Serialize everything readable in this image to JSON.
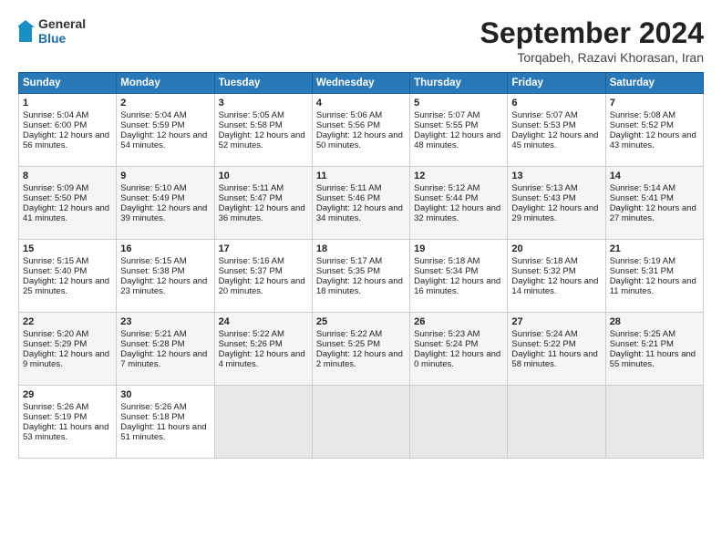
{
  "header": {
    "logo_line1": "General",
    "logo_line2": "Blue",
    "month_title": "September 2024",
    "location": "Torqabeh, Razavi Khorasan, Iran"
  },
  "days_of_week": [
    "Sunday",
    "Monday",
    "Tuesday",
    "Wednesday",
    "Thursday",
    "Friday",
    "Saturday"
  ],
  "weeks": [
    [
      {
        "day": "1",
        "sunrise": "Sunrise: 5:04 AM",
        "sunset": "Sunset: 6:00 PM",
        "daylight": "Daylight: 12 hours and 56 minutes."
      },
      {
        "day": "2",
        "sunrise": "Sunrise: 5:04 AM",
        "sunset": "Sunset: 5:59 PM",
        "daylight": "Daylight: 12 hours and 54 minutes."
      },
      {
        "day": "3",
        "sunrise": "Sunrise: 5:05 AM",
        "sunset": "Sunset: 5:58 PM",
        "daylight": "Daylight: 12 hours and 52 minutes."
      },
      {
        "day": "4",
        "sunrise": "Sunrise: 5:06 AM",
        "sunset": "Sunset: 5:56 PM",
        "daylight": "Daylight: 12 hours and 50 minutes."
      },
      {
        "day": "5",
        "sunrise": "Sunrise: 5:07 AM",
        "sunset": "Sunset: 5:55 PM",
        "daylight": "Daylight: 12 hours and 48 minutes."
      },
      {
        "day": "6",
        "sunrise": "Sunrise: 5:07 AM",
        "sunset": "Sunset: 5:53 PM",
        "daylight": "Daylight: 12 hours and 45 minutes."
      },
      {
        "day": "7",
        "sunrise": "Sunrise: 5:08 AM",
        "sunset": "Sunset: 5:52 PM",
        "daylight": "Daylight: 12 hours and 43 minutes."
      }
    ],
    [
      {
        "day": "8",
        "sunrise": "Sunrise: 5:09 AM",
        "sunset": "Sunset: 5:50 PM",
        "daylight": "Daylight: 12 hours and 41 minutes."
      },
      {
        "day": "9",
        "sunrise": "Sunrise: 5:10 AM",
        "sunset": "Sunset: 5:49 PM",
        "daylight": "Daylight: 12 hours and 39 minutes."
      },
      {
        "day": "10",
        "sunrise": "Sunrise: 5:11 AM",
        "sunset": "Sunset: 5:47 PM",
        "daylight": "Daylight: 12 hours and 36 minutes."
      },
      {
        "day": "11",
        "sunrise": "Sunrise: 5:11 AM",
        "sunset": "Sunset: 5:46 PM",
        "daylight": "Daylight: 12 hours and 34 minutes."
      },
      {
        "day": "12",
        "sunrise": "Sunrise: 5:12 AM",
        "sunset": "Sunset: 5:44 PM",
        "daylight": "Daylight: 12 hours and 32 minutes."
      },
      {
        "day": "13",
        "sunrise": "Sunrise: 5:13 AM",
        "sunset": "Sunset: 5:43 PM",
        "daylight": "Daylight: 12 hours and 29 minutes."
      },
      {
        "day": "14",
        "sunrise": "Sunrise: 5:14 AM",
        "sunset": "Sunset: 5:41 PM",
        "daylight": "Daylight: 12 hours and 27 minutes."
      }
    ],
    [
      {
        "day": "15",
        "sunrise": "Sunrise: 5:15 AM",
        "sunset": "Sunset: 5:40 PM",
        "daylight": "Daylight: 12 hours and 25 minutes."
      },
      {
        "day": "16",
        "sunrise": "Sunrise: 5:15 AM",
        "sunset": "Sunset: 5:38 PM",
        "daylight": "Daylight: 12 hours and 23 minutes."
      },
      {
        "day": "17",
        "sunrise": "Sunrise: 5:16 AM",
        "sunset": "Sunset: 5:37 PM",
        "daylight": "Daylight: 12 hours and 20 minutes."
      },
      {
        "day": "18",
        "sunrise": "Sunrise: 5:17 AM",
        "sunset": "Sunset: 5:35 PM",
        "daylight": "Daylight: 12 hours and 18 minutes."
      },
      {
        "day": "19",
        "sunrise": "Sunrise: 5:18 AM",
        "sunset": "Sunset: 5:34 PM",
        "daylight": "Daylight: 12 hours and 16 minutes."
      },
      {
        "day": "20",
        "sunrise": "Sunrise: 5:18 AM",
        "sunset": "Sunset: 5:32 PM",
        "daylight": "Daylight: 12 hours and 14 minutes."
      },
      {
        "day": "21",
        "sunrise": "Sunrise: 5:19 AM",
        "sunset": "Sunset: 5:31 PM",
        "daylight": "Daylight: 12 hours and 11 minutes."
      }
    ],
    [
      {
        "day": "22",
        "sunrise": "Sunrise: 5:20 AM",
        "sunset": "Sunset: 5:29 PM",
        "daylight": "Daylight: 12 hours and 9 minutes."
      },
      {
        "day": "23",
        "sunrise": "Sunrise: 5:21 AM",
        "sunset": "Sunset: 5:28 PM",
        "daylight": "Daylight: 12 hours and 7 minutes."
      },
      {
        "day": "24",
        "sunrise": "Sunrise: 5:22 AM",
        "sunset": "Sunset: 5:26 PM",
        "daylight": "Daylight: 12 hours and 4 minutes."
      },
      {
        "day": "25",
        "sunrise": "Sunrise: 5:22 AM",
        "sunset": "Sunset: 5:25 PM",
        "daylight": "Daylight: 12 hours and 2 minutes."
      },
      {
        "day": "26",
        "sunrise": "Sunrise: 5:23 AM",
        "sunset": "Sunset: 5:24 PM",
        "daylight": "Daylight: 12 hours and 0 minutes."
      },
      {
        "day": "27",
        "sunrise": "Sunrise: 5:24 AM",
        "sunset": "Sunset: 5:22 PM",
        "daylight": "Daylight: 11 hours and 58 minutes."
      },
      {
        "day": "28",
        "sunrise": "Sunrise: 5:25 AM",
        "sunset": "Sunset: 5:21 PM",
        "daylight": "Daylight: 11 hours and 55 minutes."
      }
    ],
    [
      {
        "day": "29",
        "sunrise": "Sunrise: 5:26 AM",
        "sunset": "Sunset: 5:19 PM",
        "daylight": "Daylight: 11 hours and 53 minutes."
      },
      {
        "day": "30",
        "sunrise": "Sunrise: 5:26 AM",
        "sunset": "Sunset: 5:18 PM",
        "daylight": "Daylight: 11 hours and 51 minutes."
      },
      {
        "day": "",
        "sunrise": "",
        "sunset": "",
        "daylight": ""
      },
      {
        "day": "",
        "sunrise": "",
        "sunset": "",
        "daylight": ""
      },
      {
        "day": "",
        "sunrise": "",
        "sunset": "",
        "daylight": ""
      },
      {
        "day": "",
        "sunrise": "",
        "sunset": "",
        "daylight": ""
      },
      {
        "day": "",
        "sunrise": "",
        "sunset": "",
        "daylight": ""
      }
    ]
  ]
}
